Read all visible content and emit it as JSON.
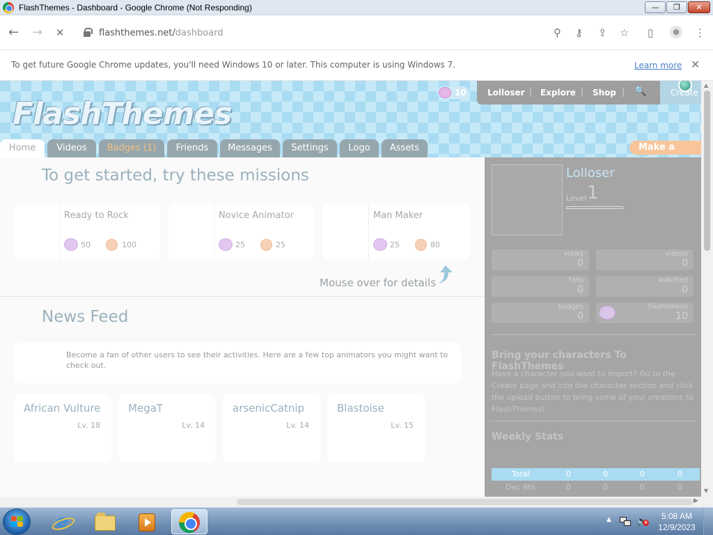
{
  "window": {
    "title": "FlashThemes - Dashboard - Google Chrome (Not Responding)",
    "min_glyph": "—",
    "max_glyph": "❐",
    "close_glyph": "✕"
  },
  "browser": {
    "back_glyph": "←",
    "forward_glyph": "→",
    "stop_glyph": "✕",
    "url_host": "flashthemes.net/",
    "url_path": "dashboard",
    "icons": [
      "zoom-icon",
      "key-icon",
      "share-icon",
      "bookmark-star-icon",
      "side-panel-icon",
      "profile-icon",
      "menu-icon"
    ],
    "zoom_glyph": "⚲",
    "key_glyph": "⚷",
    "share_glyph": "⇪",
    "star_glyph": "☆",
    "panel_glyph": "▯",
    "profile_glyph": "●",
    "menu_glyph": "⋮"
  },
  "infobar": {
    "message": "To get future Google Chrome updates, you'll need Windows 10 or later. This computer is using Windows 7.",
    "learn_more": "Learn more",
    "close_glyph": "✕"
  },
  "site": {
    "logo": "FlashThemes",
    "token_count": "10",
    "topnav": {
      "user": "Lolloser",
      "explore": "Explore",
      "shop": "Shop",
      "search_glyph": "🔍",
      "create": "Create",
      "sep": "|"
    },
    "tabs": [
      "Home",
      "Videos",
      "Badges (1)",
      "Friends",
      "Messages",
      "Settings",
      "Logo",
      "Assets"
    ],
    "make_video": "Make a Video"
  },
  "missions": {
    "title": "To get started, try these missions",
    "items": [
      {
        "name": "Ready to Rock",
        "tokens": "50",
        "coins": "100"
      },
      {
        "name": "Novice Animator",
        "tokens": "25",
        "coins": "25"
      },
      {
        "name": "Man Maker",
        "tokens": "25",
        "coins": "80"
      }
    ],
    "mouseover": "Mouse over for details"
  },
  "news": {
    "title": "News Feed",
    "message": "Become a fan of other users to see their activities. Here are a few top animators you might want to check out.",
    "users": [
      {
        "name": "African Vulture",
        "level": "Lv. 18"
      },
      {
        "name": "MegaT",
        "level": "Lv. 14"
      },
      {
        "name": "arsenicCatnip",
        "level": "Lv. 14"
      },
      {
        "name": "Blastoise",
        "level": "Lv. 15"
      }
    ]
  },
  "sidebar": {
    "username": "Lolloser",
    "level_label": "Level",
    "level": "1",
    "stats": [
      {
        "label": "views",
        "value": "0"
      },
      {
        "label": "videos",
        "value": "0"
      },
      {
        "label": "fans",
        "value": "0"
      },
      {
        "label": "watched",
        "value": "0"
      },
      {
        "label": "badges",
        "value": "0"
      },
      {
        "label": "flashtokens",
        "value": "10"
      }
    ],
    "bring_title": "Bring your characters To FlashThemes",
    "bring_text": "Have a character you want to import? Go to the Create page and into the character section and click the upload button to bring some of your creations to FlashThemes!",
    "weekly_title": "Weekly Stats",
    "weekly_rows": [
      {
        "label": "Total",
        "v1": "0",
        "v2": "0",
        "v3": "0",
        "v4": "0"
      },
      {
        "label": "Dec 9th",
        "v1": "0",
        "v2": "0",
        "v3": "0",
        "v4": "0"
      }
    ]
  },
  "taskbar": {
    "time": "5:08 AM",
    "date": "12/9/2023",
    "tray_arrow": "▲",
    "volume_glyph": "🔈",
    "mute_glyph": "×",
    "apps": [
      "internet-explorer",
      "file-explorer",
      "media-player",
      "google-chrome"
    ]
  },
  "colors": {
    "banner_blue": "#a9dcf2",
    "tab_gray": "#96a6ad",
    "sidebar_gray": "#a5a5a5",
    "make_video_orange": "#f8c59a",
    "titlebar": "#dfe7f1",
    "taskbar": "#6f8fb4"
  }
}
